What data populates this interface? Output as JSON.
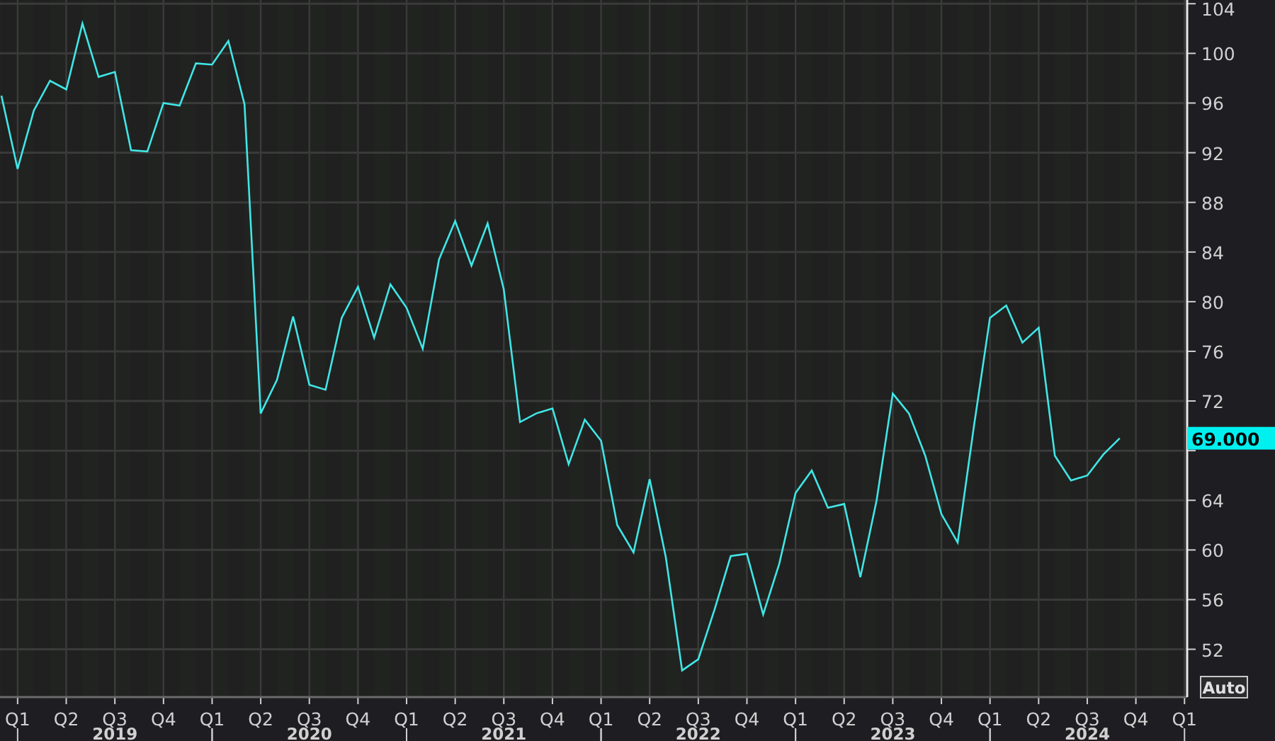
{
  "chart": {
    "chart_data": {
      "type": "line",
      "categories": [
        null,
        "Q1",
        null,
        null,
        "Q2",
        null,
        null,
        "Q3",
        null,
        null,
        "Q4",
        null,
        null,
        "Q1",
        null,
        null,
        "Q2",
        null,
        null,
        "Q3",
        null,
        null,
        "Q4",
        null,
        null,
        "Q1",
        null,
        null,
        "Q2",
        null,
        null,
        "Q3",
        null,
        null,
        "Q4",
        null,
        null,
        "Q1",
        null,
        null,
        "Q2",
        null,
        null,
        "Q3",
        null,
        null,
        "Q4",
        null,
        null,
        "Q1",
        null,
        null,
        "Q2",
        null,
        null,
        "Q3",
        null,
        null,
        "Q4",
        null,
        null,
        "Q1",
        null,
        null,
        "Q2",
        null,
        null,
        "Q3",
        null,
        null,
        "Q4",
        null,
        null,
        "Q1"
      ],
      "series": [
        {
          "color": "#40e6e6",
          "values": [
            96.6,
            90.7,
            95.4,
            97.8,
            97.1,
            102.4,
            98.1,
            98.5,
            92.2,
            92.1,
            96.0,
            95.8,
            99.2,
            99.1,
            101.0,
            95.9,
            71.0,
            73.7,
            78.8,
            73.3,
            72.9,
            78.7,
            81.2,
            77.1,
            81.4,
            79.5,
            76.2,
            83.4,
            86.5,
            82.9,
            86.3,
            81.0,
            70.3,
            71.0,
            71.4,
            66.9,
            70.5,
            68.8,
            62.0,
            59.8,
            65.7,
            59.4,
            50.3,
            51.2,
            55.2,
            59.5,
            59.7,
            54.8,
            58.9,
            64.6,
            66.4,
            63.4,
            63.7,
            57.8,
            64.0,
            72.6,
            71.0,
            67.6,
            62.9,
            60.6,
            69.9,
            78.7,
            79.7,
            76.7,
            77.9,
            67.6,
            65.6,
            66.0,
            67.7,
            69.0,
            null,
            null,
            null,
            null
          ]
        }
      ],
      "ylim": [
        48.15,
        104.3
      ],
      "grid": true,
      "yticks": [
        52,
        56,
        60,
        64,
        72,
        76,
        80,
        84,
        88,
        92,
        96,
        100,
        104
      ]
    },
    "year_labels": [
      "2019",
      "2020",
      "2021",
      "2022",
      "2023",
      "2024"
    ],
    "last_value_label": "69.000"
  },
  "auto_button": {
    "label": "Auto"
  }
}
